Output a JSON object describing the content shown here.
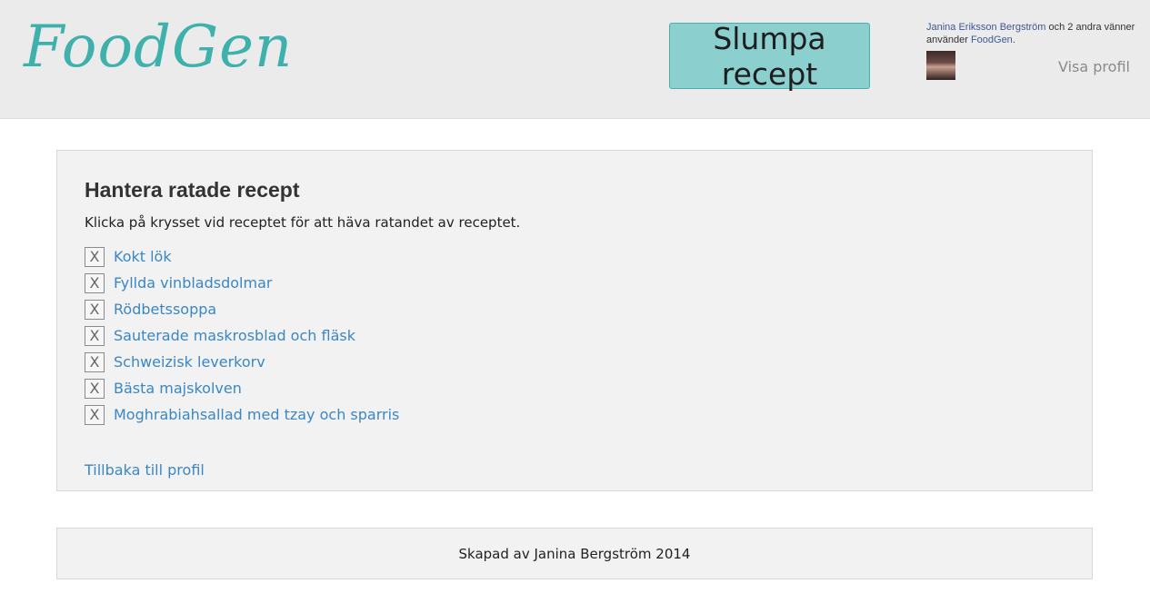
{
  "header": {
    "logo": "FoodGen",
    "random_button": "Slumpa recept",
    "social": {
      "friend_name": "Janina Eriksson Bergström",
      "middle_text": " och 2 andra vänner använder ",
      "app_name": "FoodGen",
      "end_text": "."
    },
    "view_profile": "Visa profil"
  },
  "main": {
    "title": "Hantera ratade recept",
    "instruction": "Klicka på krysset vid receptet för att häva ratandet av receptet.",
    "remove_symbol": "X",
    "recipes": [
      "Kokt lök",
      "Fyllda vinbladsdolmar",
      "Rödbetssoppa",
      "Sauterade maskrosblad och fläsk",
      "Schweizisk leverkorv",
      "Bästa majskolven",
      "Moghrabiahsallad med tzay och sparris"
    ],
    "back_link": "Tillbaka till profil"
  },
  "footer": {
    "text": "Skapad av Janina Bergström 2014"
  },
  "colors": {
    "brand": "#3fb1ad",
    "button_bg": "#8bcfcf",
    "link": "#3a87c5",
    "facebook_link": "#3b5998"
  }
}
